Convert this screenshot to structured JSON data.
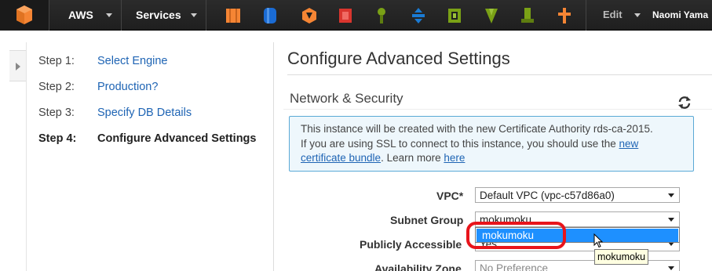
{
  "topbar": {
    "brand": "AWS",
    "services": "Services",
    "edit": "Edit",
    "user": "Naomi Yama",
    "service_icons": [
      {
        "name": "ec2-icon",
        "color": "#f58534"
      },
      {
        "name": "s3-icon",
        "color": "#1a6bd4"
      },
      {
        "name": "lambda-icon",
        "color": "#f58534"
      },
      {
        "name": "cloudformation-icon",
        "color": "#d9352e"
      },
      {
        "name": "elasticbeanstalk-icon",
        "color": "#7aa116"
      },
      {
        "name": "codedeploy-icon",
        "color": "#1a7bd4"
      },
      {
        "name": "vpc-icon",
        "color": "#7aa116"
      },
      {
        "name": "cloudwatch-icon",
        "color": "#7aa116"
      },
      {
        "name": "opsworks-icon",
        "color": "#7aa116"
      },
      {
        "name": "tools-icon",
        "color": "#f58534"
      }
    ]
  },
  "steps": [
    {
      "number": "Step 1:",
      "label": "Select Engine"
    },
    {
      "number": "Step 2:",
      "label": "Production?"
    },
    {
      "number": "Step 3:",
      "label": "Specify DB Details"
    },
    {
      "number": "Step 4:",
      "label": "Configure Advanced Settings"
    }
  ],
  "main": {
    "title": "Configure Advanced Settings",
    "section_title": "Network & Security",
    "info": {
      "line1": "This instance will be created with the new Certificate Authority rds-ca-2015.",
      "line2_prefix": "If you are using SSL to connect to this instance, you should use the ",
      "link1_part1": "new",
      "link1_part2": "certificate bundle",
      "learn_more": ". Learn more ",
      "link2": "here"
    },
    "fields": {
      "vpc_label": "VPC*",
      "vpc_value": "Default VPC (vpc-c57d86a0)",
      "subnet_label": "Subnet Group",
      "subnet_value": "mokumoku",
      "subnet_option": "mokumoku",
      "public_label": "Publicly Accessible",
      "public_value": "Yes",
      "az_label": "Availability Zone",
      "az_value": "No Preference"
    },
    "tooltip": "mokumoku"
  }
}
